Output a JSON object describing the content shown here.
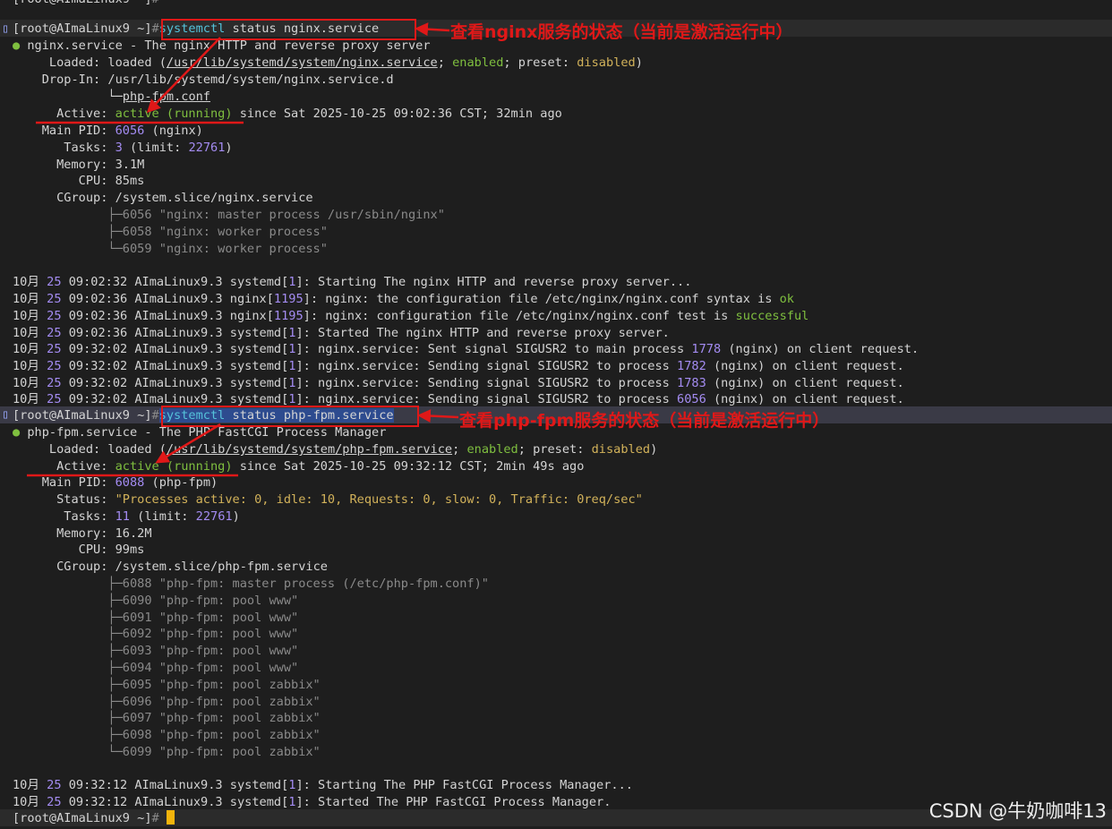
{
  "prompt": {
    "open": "[root@AImaLinux9 ~]",
    "hash": "#"
  },
  "cmd1": {
    "verb": "systemctl",
    "rest": " status nginx.service"
  },
  "nginx": {
    "bullet": "●",
    "unit": "nginx.service",
    "desc": " - The nginx HTTP and reverse proxy server",
    "loaded_label": "Loaded:",
    "loaded_pre": "loaded (",
    "loaded_path": "/usr/lib/systemd/system/nginx.service",
    "loaded_sep1": "; ",
    "enabled": "enabled",
    "loaded_sep2": "; preset: ",
    "preset": "disabled",
    "loaded_post": ")",
    "dropin_label": "Drop-In:",
    "dropin_path": "/usr/lib/systemd/system/nginx.service.d",
    "dropin_tree": "└─",
    "dropin_file": "php-fpm.conf",
    "active_label": "Active:",
    "active_state": "active (running)",
    "active_since": " since Sat 2025-10-25 09:02:36 CST; 32min ago",
    "pid_label": "Main PID:",
    "pid": "6056",
    "pid_name": " (nginx)",
    "tasks_label": "Tasks:",
    "tasks": "3",
    "tasks_limit_pre": " (limit: ",
    "tasks_limit": "22761",
    "tasks_limit_post": ")",
    "mem_label": "Memory:",
    "mem": "3.1M",
    "cpu_label": "CPU:",
    "cpu": "85ms",
    "cgroup_label": "CGroup:",
    "cgroup": "/system.slice/nginx.service",
    "procs": [
      "├─6056 \"nginx: master process /usr/sbin/nginx\"",
      "├─6058 \"nginx: worker process\"",
      "└─6059 \"nginx: worker process\""
    ]
  },
  "log1": [
    {
      "mon": "10月",
      "day": "25",
      "time": " 09:02:32 AImaLinux9.3 ",
      "proc": "systemd",
      "pid": "1",
      "msg": "Starting The nginx HTTP and reverse proxy server..."
    },
    {
      "mon": "10月",
      "day": "25",
      "time": " 09:02:36 AImaLinux9.3 ",
      "proc": "nginx",
      "pid": "1195",
      "msg_pre": "nginx: the configuration file /etc/nginx/nginx.conf syntax is ",
      "msg_hl": "ok"
    },
    {
      "mon": "10月",
      "day": "25",
      "time": " 09:02:36 AImaLinux9.3 ",
      "proc": "nginx",
      "pid": "1195",
      "msg_pre": "nginx: configuration file /etc/nginx/nginx.conf test is ",
      "msg_hl": "successful"
    },
    {
      "mon": "10月",
      "day": "25",
      "time": " 09:02:36 AImaLinux9.3 ",
      "proc": "systemd",
      "pid": "1",
      "msg": "Started The nginx HTTP and reverse proxy server."
    },
    {
      "mon": "10月",
      "day": "25",
      "time": " 09:32:02 AImaLinux9.3 ",
      "proc": "systemd",
      "pid": "1",
      "msg_pre": "nginx.service: Sent signal SIGUSR2 to main process ",
      "msg_num": "1778",
      "msg_post": " (nginx) on client request."
    },
    {
      "mon": "10月",
      "day": "25",
      "time": " 09:32:02 AImaLinux9.3 ",
      "proc": "systemd",
      "pid": "1",
      "msg_pre": "nginx.service: Sending signal SIGUSR2 to process ",
      "msg_num": "1782",
      "msg_post": " (nginx) on client request."
    },
    {
      "mon": "10月",
      "day": "25",
      "time": " 09:32:02 AImaLinux9.3 ",
      "proc": "systemd",
      "pid": "1",
      "msg_pre": "nginx.service: Sending signal SIGUSR2 to process ",
      "msg_num": "1783",
      "msg_post": " (nginx) on client request."
    },
    {
      "mon": "10月",
      "day": "25",
      "time": " 09:32:02 AImaLinux9.3 ",
      "proc": "systemd",
      "pid": "1",
      "msg_pre": "nginx.service: Sending signal SIGUSR2 to process ",
      "msg_num": "6056",
      "msg_post": " (nginx) on client request."
    }
  ],
  "cmd2": {
    "verb": "systemctl",
    "rest": " status php-fpm.service"
  },
  "phpfpm": {
    "bullet": "●",
    "unit": "php-fpm.service",
    "desc": " - The PHP FastCGI Process Manager",
    "loaded_label": "Loaded:",
    "loaded_pre": "loaded (",
    "loaded_path": "/usr/lib/systemd/system/php-fpm.service",
    "loaded_sep1": "; ",
    "enabled": "enabled",
    "loaded_sep2": "; preset: ",
    "preset": "disabled",
    "loaded_post": ")",
    "active_label": "Active:",
    "active_state": "active (running)",
    "active_since": " since Sat 2025-10-25 09:32:12 CST; 2min 49s ago",
    "pid_label": "Main PID:",
    "pid": "6088",
    "pid_name": " (php-fpm)",
    "status_label": "Status:",
    "status": "\"Processes active: 0, idle: 10, Requests: 0, slow: 0, Traffic: 0req/sec\"",
    "tasks_label": "Tasks:",
    "tasks": "11",
    "tasks_limit_pre": " (limit: ",
    "tasks_limit": "22761",
    "tasks_limit_post": ")",
    "mem_label": "Memory:",
    "mem": "16.2M",
    "cpu_label": "CPU:",
    "cpu": "99ms",
    "cgroup_label": "CGroup:",
    "cgroup": "/system.slice/php-fpm.service",
    "procs": [
      "├─6088 \"php-fpm: master process (/etc/php-fpm.conf)\"",
      "├─6090 \"php-fpm: pool www\"",
      "├─6091 \"php-fpm: pool www\"",
      "├─6092 \"php-fpm: pool www\"",
      "├─6093 \"php-fpm: pool www\"",
      "├─6094 \"php-fpm: pool www\"",
      "├─6095 \"php-fpm: pool zabbix\"",
      "├─6096 \"php-fpm: pool zabbix\"",
      "├─6097 \"php-fpm: pool zabbix\"",
      "├─6098 \"php-fpm: pool zabbix\"",
      "└─6099 \"php-fpm: pool zabbix\""
    ]
  },
  "log2": [
    {
      "mon": "10月",
      "day": "25",
      "time": " 09:32:12 AImaLinux9.3 ",
      "proc": "systemd",
      "pid": "1",
      "msg": "Starting The PHP FastCGI Process Manager..."
    },
    {
      "mon": "10月",
      "day": "25",
      "time": " 09:32:12 AImaLinux9.3 ",
      "proc": "systemd",
      "pid": "1",
      "msg": "Started The PHP FastCGI Process Manager."
    }
  ],
  "annotations": {
    "nginx_note_a": "查看",
    "nginx_note_b": "nginx",
    "nginx_note_c": "服务的状态（当前是激活运行中）",
    "php_note_a": "查看",
    "php_note_b": "php-fpm",
    "php_note_c": "服务的状态（当前是激活运行中）"
  },
  "watermark": "CSDN @牛奶咖啡13",
  "colors": {
    "background": "#1e1e1e",
    "annotation_red": "#e01818",
    "cursor": "#f2b40c"
  }
}
